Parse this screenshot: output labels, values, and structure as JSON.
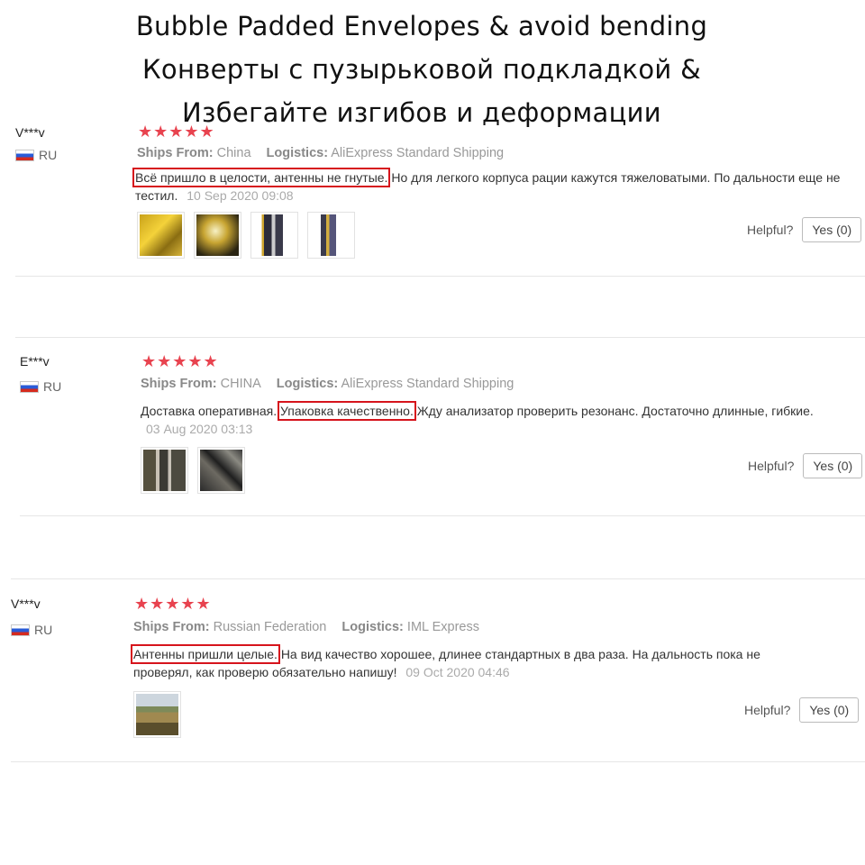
{
  "headline": {
    "line1": "Bubble Padded Envelopes & avoid bending",
    "line2": "Конверты с пузырьковой подкладкой &",
    "line3": "Избегайте изгибов и деформации"
  },
  "labels": {
    "ships_from": "Ships From:",
    "logistics": "Logistics:",
    "helpful": "Helpful?"
  },
  "reviews": [
    {
      "user": "V***v",
      "country": "RU",
      "stars": "★★★★★",
      "ships_from": "China",
      "logistics": "AliExpress Standard Shipping",
      "highlight": "Всё пришло в целости, антенны не гнутые.",
      "text": "Но для легкого корпуса рации кажутся тяжеловатыми. По дальности еще не тестил.",
      "date": "10 Sep 2020 09:08",
      "helpful_btn": "Yes (0)",
      "photos": 4
    },
    {
      "user": "E***v",
      "country": "RU",
      "stars": "★★★★★",
      "ships_from": "CHINA",
      "logistics": "AliExpress Standard Shipping",
      "pre": "Доставка оперативная.",
      "highlight": "Упаковка качественно.",
      "text": "Жду анализатор проверить резонанс. Достаточно длинные, гибкие.",
      "date": "03 Aug 2020 03:13",
      "helpful_btn": "Yes (0)",
      "photos": 2
    },
    {
      "user": "V***v",
      "country": "RU",
      "stars": "★★★★★",
      "ships_from": "Russian Federation",
      "logistics": "IML Express",
      "highlight": "Антенны пришли целые.",
      "text": "На вид качество хорошее, длинее стандартных в два раза. На дальность пока не проверял, как проверю обязательно напишу!",
      "date": "09 Oct 2020 04:46",
      "helpful_btn": "Yes (0)",
      "photos": 1
    }
  ]
}
